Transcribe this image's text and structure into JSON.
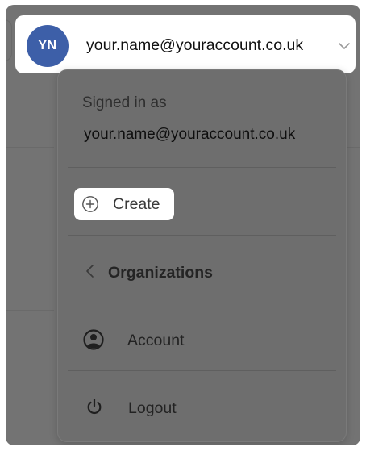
{
  "account_bar": {
    "avatar_initials": "YN",
    "email": "your.name@youraccount.co.uk",
    "chevron_icon": "chevron-down-icon"
  },
  "menu": {
    "signed_in_label": "Signed in as",
    "signed_in_email": "your.name@youraccount.co.uk",
    "create_label": "Create",
    "create_icon": "plus-circle-icon",
    "items": [
      {
        "label": "Organizations",
        "icon": "chevron-left-icon"
      },
      {
        "label": "Account",
        "icon": "user-circle-icon"
      },
      {
        "label": "Logout",
        "icon": "power-icon"
      }
    ]
  },
  "colors": {
    "avatar_bg": "#3d5fa8",
    "overlay": "#737373",
    "highlight": "#ffffff"
  }
}
